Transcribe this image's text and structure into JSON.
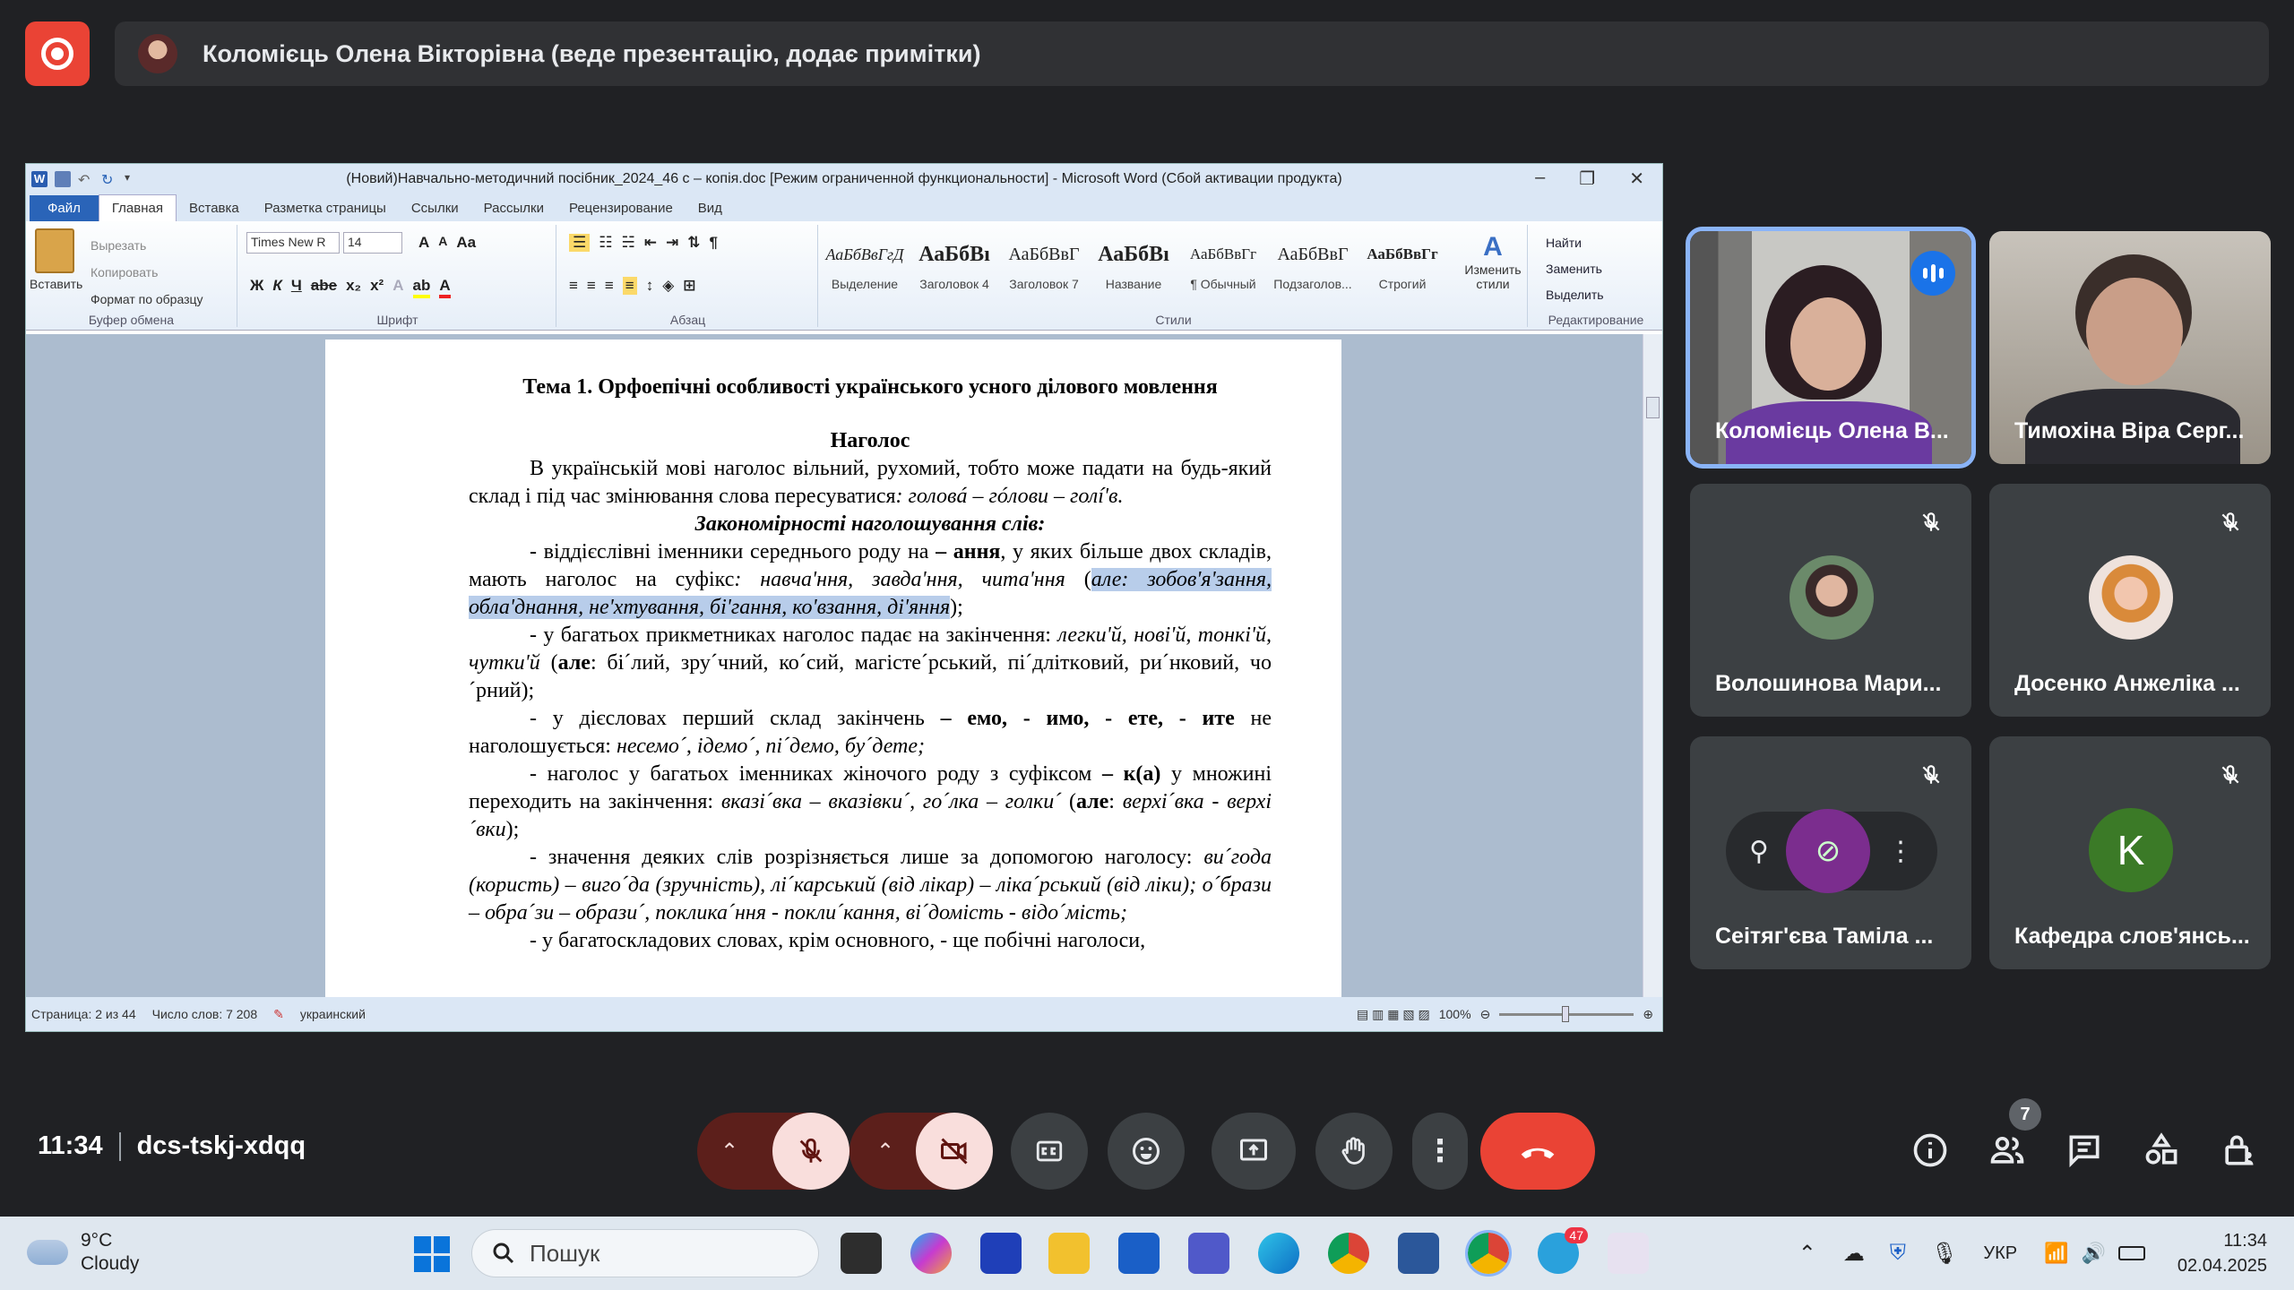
{
  "presenter": {
    "title": "Коломієць Олена Вікторівна (веде презентацію, додає примітки)"
  },
  "word": {
    "doc_title": "(Новий)Навчально-методичний посібник_2024_46 с – копія.doc [Режим ограниченной функциональности] - Microsoft Word (Сбой активации продукта)",
    "tabs": [
      "Файл",
      "Главная",
      "Вставка",
      "Разметка страницы",
      "Ссылки",
      "Рассылки",
      "Рецензирование",
      "Вид"
    ],
    "clipboard": {
      "paste": "Вставить",
      "cut": "Вырезать",
      "copy": "Копировать",
      "format": "Формат по образцу",
      "label": "Буфер обмена"
    },
    "font": {
      "name": "Times New R",
      "size": "14",
      "label": "Шрифт"
    },
    "paragraph_label": "Абзац",
    "styles": [
      {
        "sample": "АаБбВвГгД",
        "name": "Выделение"
      },
      {
        "sample": "АаБбВı",
        "name": "Заголовок 4"
      },
      {
        "sample": "АаБбВвГ",
        "name": "Заголовок 7"
      },
      {
        "sample": "АаБбВı",
        "name": "Название"
      },
      {
        "sample": "АаБбВвГг",
        "name": "¶ Обычный"
      },
      {
        "sample": "АаБбВвГ",
        "name": "Подзаголов..."
      },
      {
        "sample": "АаБбВвГг",
        "name": "Строгий"
      }
    ],
    "change_styles": "Изменить стили",
    "styles_label": "Стили",
    "editing": {
      "find": "Найти",
      "replace": "Заменить",
      "select": "Выделить",
      "label": "Редактирование"
    },
    "document": {
      "heading": "Тема 1. Орфоепічні особливості українського усного ділового мовлення",
      "subheading": "Наголос",
      "p1": "В українській мові наголос вільний, рухомий, тобто може падати на будь-який склад і під час змінювання слова пересуватися",
      "p1_example": ": головá – гóлови – голí'в.",
      "rules_title": "Закономірності наголошування слів:",
      "r1_a": "-   віддієслівні іменники середнього роду на",
      "r1_b": " – ання",
      "r1_c": ", у яких більше двох складів, мають наголос на суфікс",
      "r1_examples": ": навча'ння, завда'ння, чита'ння",
      "r1_open": " (",
      "r1_hl": "але: зобов'я'зання, обла'днання, не'хтування, бі'гання, ко'взання, ді'яння",
      "r1_close": ");",
      "r2_a": "-   у багатьох прикметниках наголос падає на закінчення: ",
      "r2_examples": "легки'й, нові'й, тонкі'й, чутки'й",
      "r2_b": " (",
      "r2_but": "але",
      "r2_c": ": бі´лий, зру´чний, ко´сий, магісте´рський, пі´дліткoвий, ри´нковий, чо´рний);",
      "r3_a": "-   у дієсловах перший склад закінчень ",
      "r3_bold": "– емо, - имо, - ете, - ите",
      "r3_b": " не наголошується: ",
      "r3_examples": "несемо´, ідемо´, пі´демо, бу´дете;",
      "r4_a": "-   наголос у багатьох іменниках жіночого роду з суфіксом ",
      "r4_bold": "– к(а)",
      "r4_b": " у множині переходить на закінчення: ",
      "r4_examples": "вказі´вка – вказівки´, го´лка – голки´",
      "r4_c": " (",
      "r4_but": "але",
      "r4_d": ": ",
      "r4_examples2": "верхі´вка - верхі´вки",
      "r4_e": ");",
      "r5_a": "-   значення деяких слів розрізняється лише за допомогою наголосу: ",
      "r5_examples": "ви´года (користь) – виго´да (зручність), лі´карський (від лікар) – ліка´рський (від ліки); о´брази – обра´зи – образи´, поклика´ння - покли´кання, ві´домість - відо´мість;",
      "r6": "-   у багатоскладових словах, крім основного, - ще побічні наголоси,"
    },
    "status": {
      "page": "Страница: 2 из 44",
      "words": "Число слов: 7 208",
      "lang": "украинский",
      "zoom": "100%"
    }
  },
  "participants": [
    {
      "name": "Коломієць Олена В...",
      "speaking": true
    },
    {
      "name": "Тимохіна Віра Серг...",
      "speaking": false
    },
    {
      "name": "Волошинова Мари...",
      "muted": true
    },
    {
      "name": "Досенко Анжеліка ...",
      "muted": true
    },
    {
      "name": "Сеітяг'єва Таміла ...",
      "muted": true
    },
    {
      "name": "Кафедра слов'янсь...",
      "muted": true,
      "initial": "K"
    }
  ],
  "meeting": {
    "time": "11:34",
    "code": "dcs-tskj-xdqq",
    "people_count": "7"
  },
  "taskbar": {
    "temp": "9°C",
    "weather": "Cloudy",
    "search_placeholder": "Пошук",
    "lang": "УКР",
    "time": "11:34",
    "date": "02.04.2025",
    "telegram_badge": "47"
  },
  "colors": {
    "meet_bg": "#202124",
    "tile_bg": "#3c4043",
    "accent_blue": "#8ab4f8",
    "hangup_red": "#ea4335",
    "word_blue": "#2a64b8"
  }
}
